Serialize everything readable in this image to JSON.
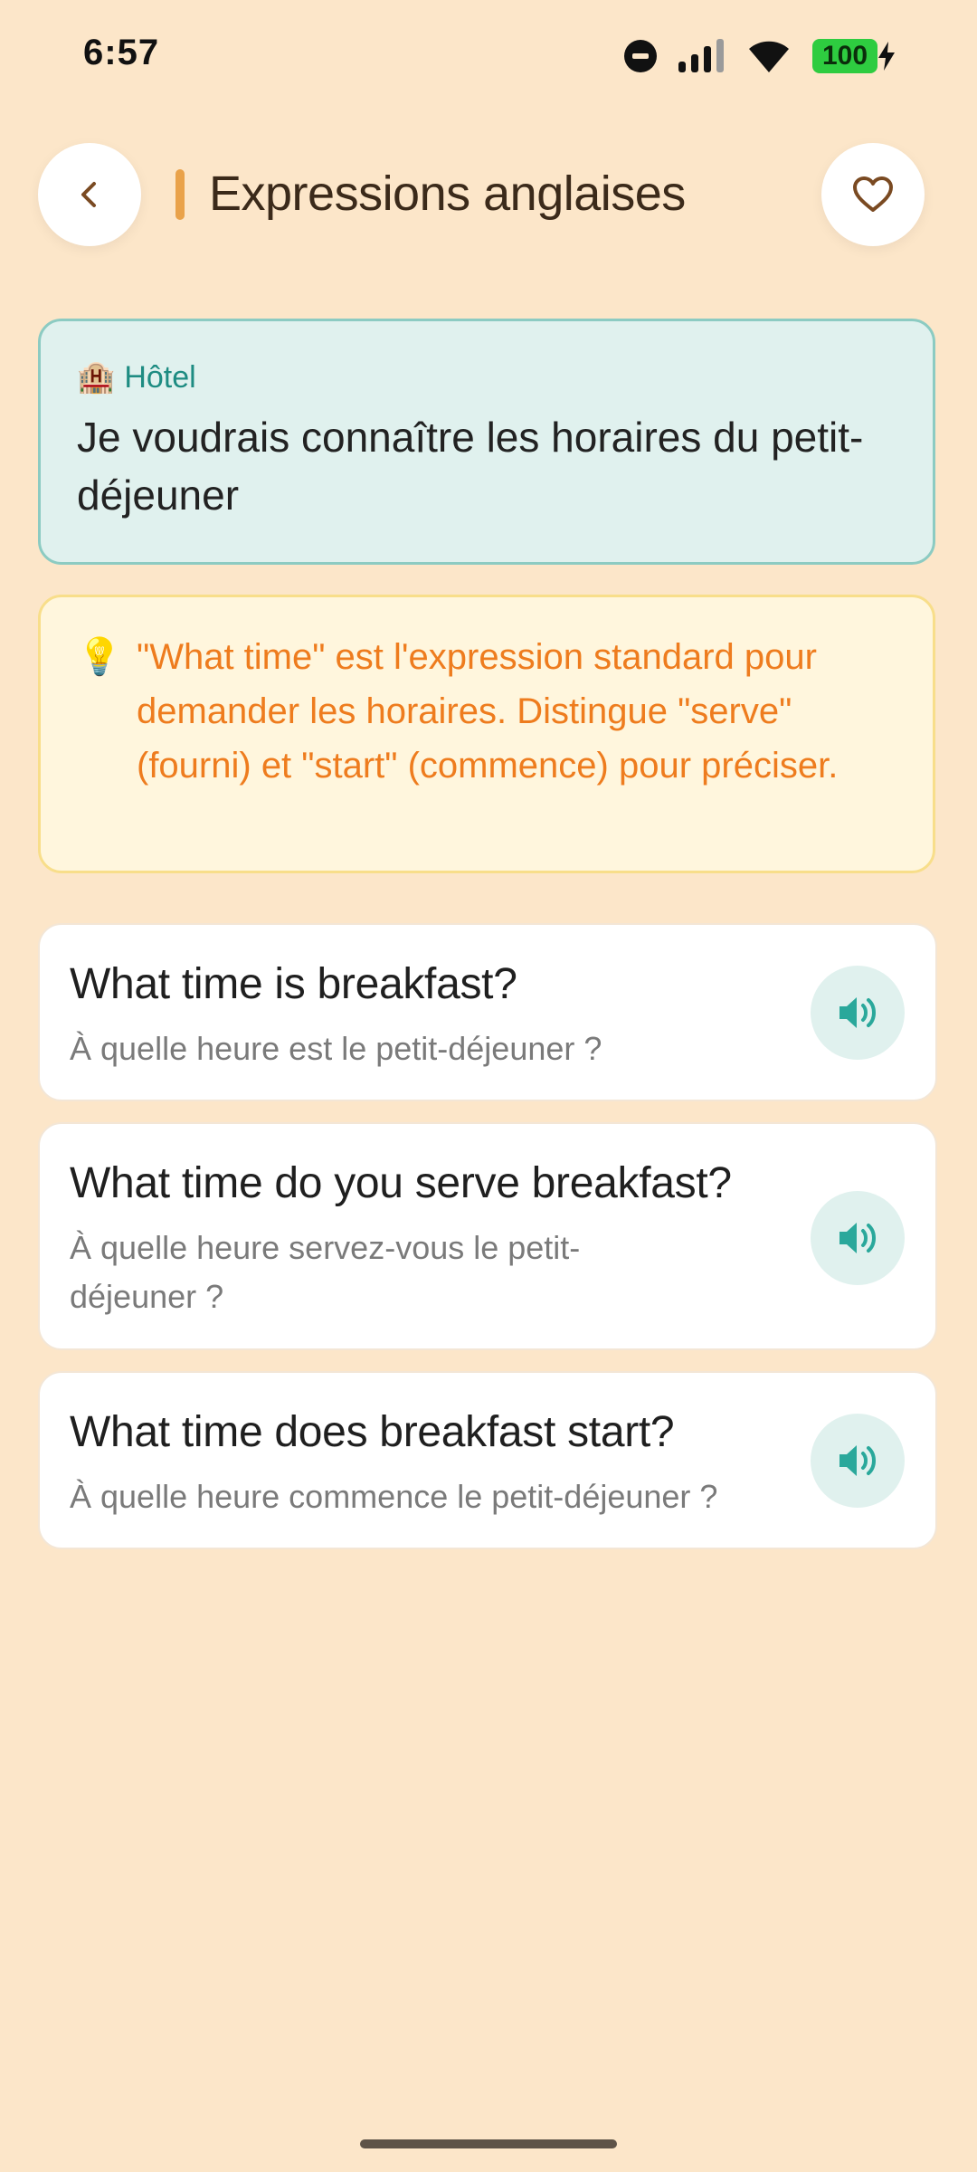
{
  "status": {
    "time": "6:57",
    "battery": "100"
  },
  "header": {
    "title": "Expressions anglaises"
  },
  "context": {
    "category_emoji": "🏨",
    "category": "Hôtel",
    "phrase": "Je voudrais connaître les horaires du petit-déjeuner"
  },
  "tip": {
    "icon": "💡",
    "text": "\"What time\" est l'expression standard pour demander les horaires. Distingue \"serve\" (fourni) et \"start\" (commence) pour préciser."
  },
  "phrases": [
    {
      "english": "What time is breakfast?",
      "french": "À quelle heure est le petit-déjeuner ?"
    },
    {
      "english": "What time do you serve breakfast?",
      "french": "À quelle heure servez-vous le petit-déjeuner ?"
    },
    {
      "english": "What time does breakfast start?",
      "french": "À quelle heure commence le petit-déjeuner ?"
    }
  ],
  "colors": {
    "background": "#FCE6C9",
    "accent": "#E9A24A",
    "teal": "#2AA89B",
    "tip_text": "#EE7C1E",
    "heart_brown": "#7A4A22"
  }
}
